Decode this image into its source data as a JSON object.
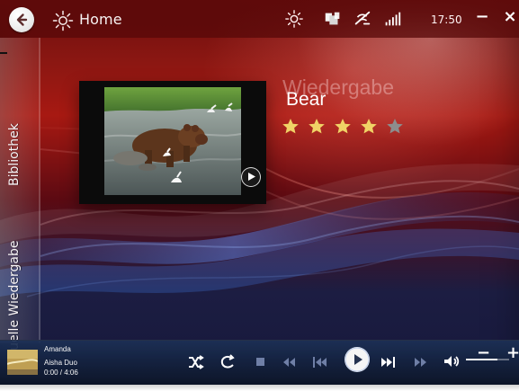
{
  "top_bar": {
    "home_label": "Home",
    "clock": "17:50",
    "minimize_glyph": "−",
    "close_glyph": "×",
    "icons": [
      "back-arrow-icon",
      "media-center-logo-icon",
      "settings-gear-icon",
      "library-icon",
      "network-connection-icon",
      "signal-strength-icon"
    ]
  },
  "side_tabs": [
    {
      "label": "Bibliothek"
    },
    {
      "label": "Aktuelle Wiedergabe"
    }
  ],
  "main": {
    "section_title": "Wiedergabe",
    "track_title": "Bear",
    "rating": {
      "value": 4,
      "max": 5,
      "filled_color": "#f0d266",
      "empty_color": "#8d8d8d"
    }
  },
  "player": {
    "artist": "Amanda",
    "album": "Aisha Duo",
    "time": "0:00 / 4:06",
    "volume_minus": "−",
    "volume_plus": "+",
    "volume_level": 0.72,
    "icons": [
      "shuffle-icon",
      "repeat-icon",
      "stop-icon",
      "rewind-icon",
      "previous-track-icon",
      "play-icon",
      "next-track-icon",
      "fast-forward-icon",
      "volume-icon"
    ]
  },
  "colors": {
    "accent_red": "#a71912",
    "deep_blue": "#16183b",
    "text": "#ffffff"
  }
}
